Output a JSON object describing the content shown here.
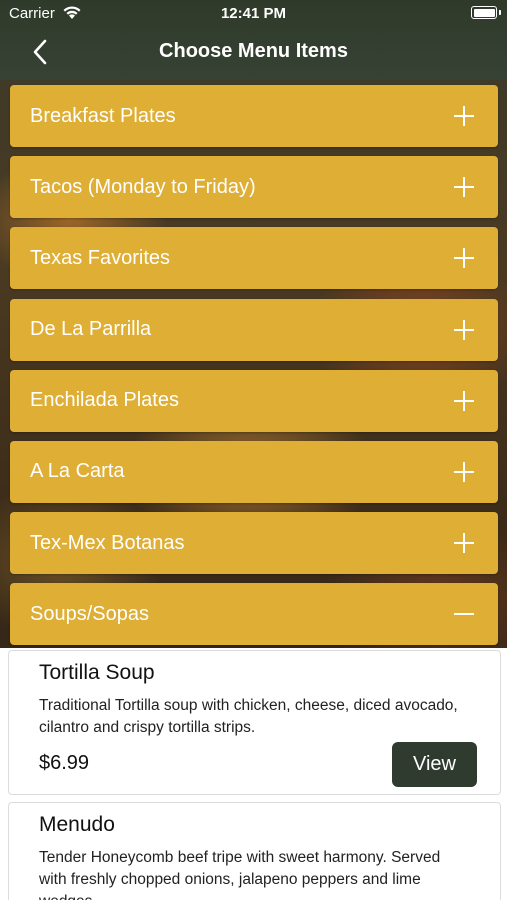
{
  "status_bar": {
    "carrier": "Carrier",
    "time": "12:41 PM"
  },
  "nav": {
    "title": "Choose Menu Items",
    "back_icon": "chevron-left-icon"
  },
  "categories": [
    {
      "label": "Breakfast Plates",
      "expanded": false
    },
    {
      "label": "Tacos (Monday to Friday)",
      "expanded": false
    },
    {
      "label": "Texas Favorites",
      "expanded": false
    },
    {
      "label": "De La Parrilla",
      "expanded": false
    },
    {
      "label": "Enchilada Plates",
      "expanded": false
    },
    {
      "label": "A La Carta",
      "expanded": false
    },
    {
      "label": "Tex-Mex Botanas",
      "expanded": false
    },
    {
      "label": "Soups/Sopas",
      "expanded": true
    }
  ],
  "items": [
    {
      "name": "Tortilla Soup",
      "description": "Traditional Tortilla soup with chicken, cheese, diced avocado, cilantro and crispy tortilla strips.",
      "price": "$6.99",
      "button": "View"
    },
    {
      "name": "Menudo",
      "description": "Tender Honeycomb beef tripe with sweet harmony. Served with freshly chopped onions, jalapeno peppers and lime wedges.",
      "price": "",
      "button": ""
    }
  ],
  "colors": {
    "category_bg": "#deae35",
    "header_bg": "#364234",
    "button_bg": "#303b30"
  }
}
